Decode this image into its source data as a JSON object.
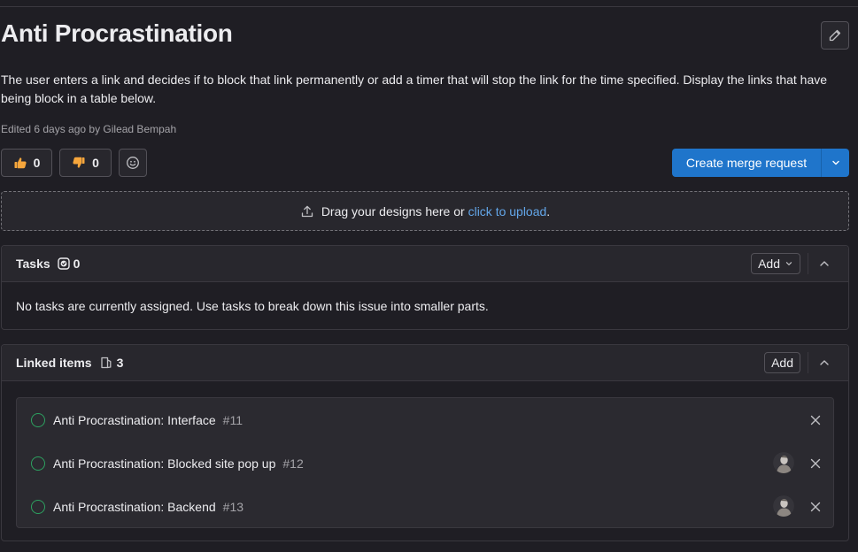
{
  "issue": {
    "title": "Anti Procrastination",
    "description": "The user enters a link and decides if to block that link permanently or add a timer that will stop the link for the time specified. Display the links that have being block in a table below.",
    "edited": "Edited 6 days ago by Gilead Bempah"
  },
  "reactions": {
    "thumbs_up": "0",
    "thumbs_down": "0"
  },
  "merge_request": {
    "label": "Create merge request"
  },
  "dropzone": {
    "text": "Drag your designs here or",
    "link": "click to upload",
    "suffix": "."
  },
  "tasks": {
    "title": "Tasks",
    "count": "0",
    "add_label": "Add",
    "empty_text": "No tasks are currently assigned. Use tasks to break down this issue into smaller parts."
  },
  "linked": {
    "title": "Linked items",
    "count": "3",
    "add_label": "Add",
    "items": [
      {
        "title": "Anti Procrastination: Interface",
        "ref": "#11",
        "has_assignee": false
      },
      {
        "title": "Anti Procrastination: Blocked site pop up",
        "ref": "#12",
        "has_assignee": true
      },
      {
        "title": "Anti Procrastination: Backend",
        "ref": "#13",
        "has_assignee": true
      }
    ]
  },
  "colors": {
    "background": "#1f1e24",
    "primary": "#1f75cb",
    "link": "#63a6e9",
    "open_status": "#2da160"
  },
  "icons": [
    "pencil-icon",
    "thumbs-up-icon",
    "thumbs-down-icon",
    "smiley-icon",
    "chevron-down-icon",
    "upload-icon",
    "task-done-icon",
    "chevron-up-icon",
    "linked-items-icon",
    "issue-open-icon",
    "close-icon",
    "avatar"
  ]
}
